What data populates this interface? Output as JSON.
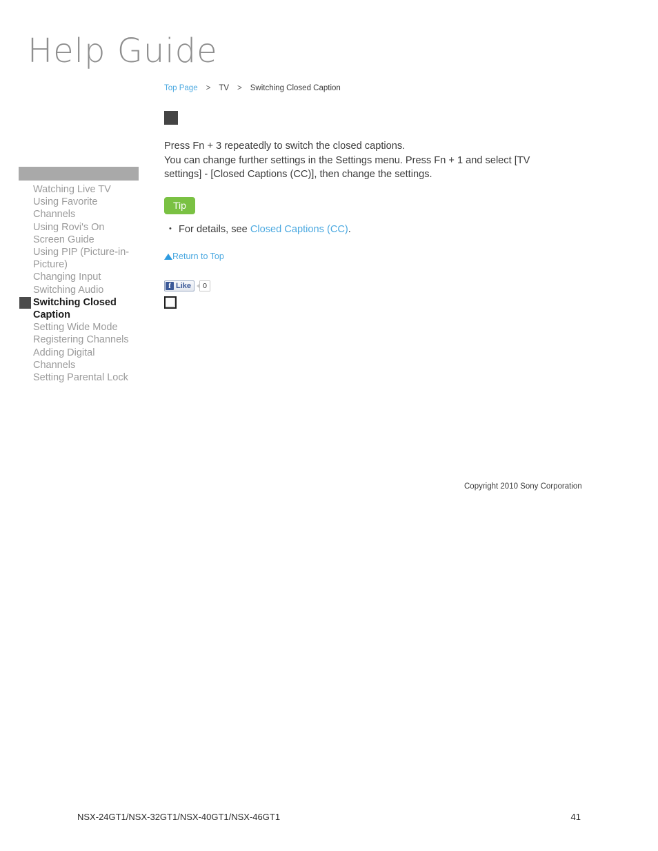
{
  "logo": {
    "text": "Help Guide"
  },
  "breadcrumb": {
    "top_page": "Top Page",
    "separator_1": ">",
    "section": "TV",
    "separator_2": ">",
    "current": "Switching Closed Caption"
  },
  "sidebar": {
    "items": [
      {
        "label": "Watching Live TV",
        "active": false
      },
      {
        "label": "Using Favorite Channels",
        "active": false
      },
      {
        "label": "Using Rovi's On Screen Guide",
        "active": false
      },
      {
        "label": "Using PIP (Picture-in-Picture)",
        "active": false
      },
      {
        "label": "Changing Input",
        "active": false
      },
      {
        "label": "Switching Audio",
        "active": false
      },
      {
        "label": "Switching Closed Caption",
        "active": true
      },
      {
        "label": "Setting Wide Mode",
        "active": false
      },
      {
        "label": "Registering Channels",
        "active": false
      },
      {
        "label": "Adding Digital Channels",
        "active": false
      },
      {
        "label": "Setting Parental Lock",
        "active": false
      }
    ]
  },
  "main": {
    "paragraph_line_1": "Press Fn + 3 repeatedly to switch the closed captions.",
    "paragraph_line_2": "You can change further settings in the Settings menu. Press Fn + 1 and select [TV settings] - [Closed Captions (CC)], then change the settings.",
    "tip_badge": "Tip",
    "tip_text_prefix": "For details, see ",
    "tip_link": "Closed Captions (CC)",
    "tip_text_suffix": ".",
    "return_to_top": "Return to Top"
  },
  "social": {
    "facebook_icon": "f",
    "like_label": "Like",
    "like_count": "0"
  },
  "copyright": "Copyright 2010 Sony Corporation",
  "footer": {
    "models": "NSX-24GT1/NSX-32GT1/NSX-40GT1/NSX-46GT1",
    "page_number": "41"
  },
  "colors": {
    "link_blue": "#4aa8e0",
    "tip_green": "#7ac143",
    "sidebar_header_gray": "#a9a9a9",
    "active_marker_gray": "#4b4b4b",
    "facebook_blue": "#3b5998"
  }
}
